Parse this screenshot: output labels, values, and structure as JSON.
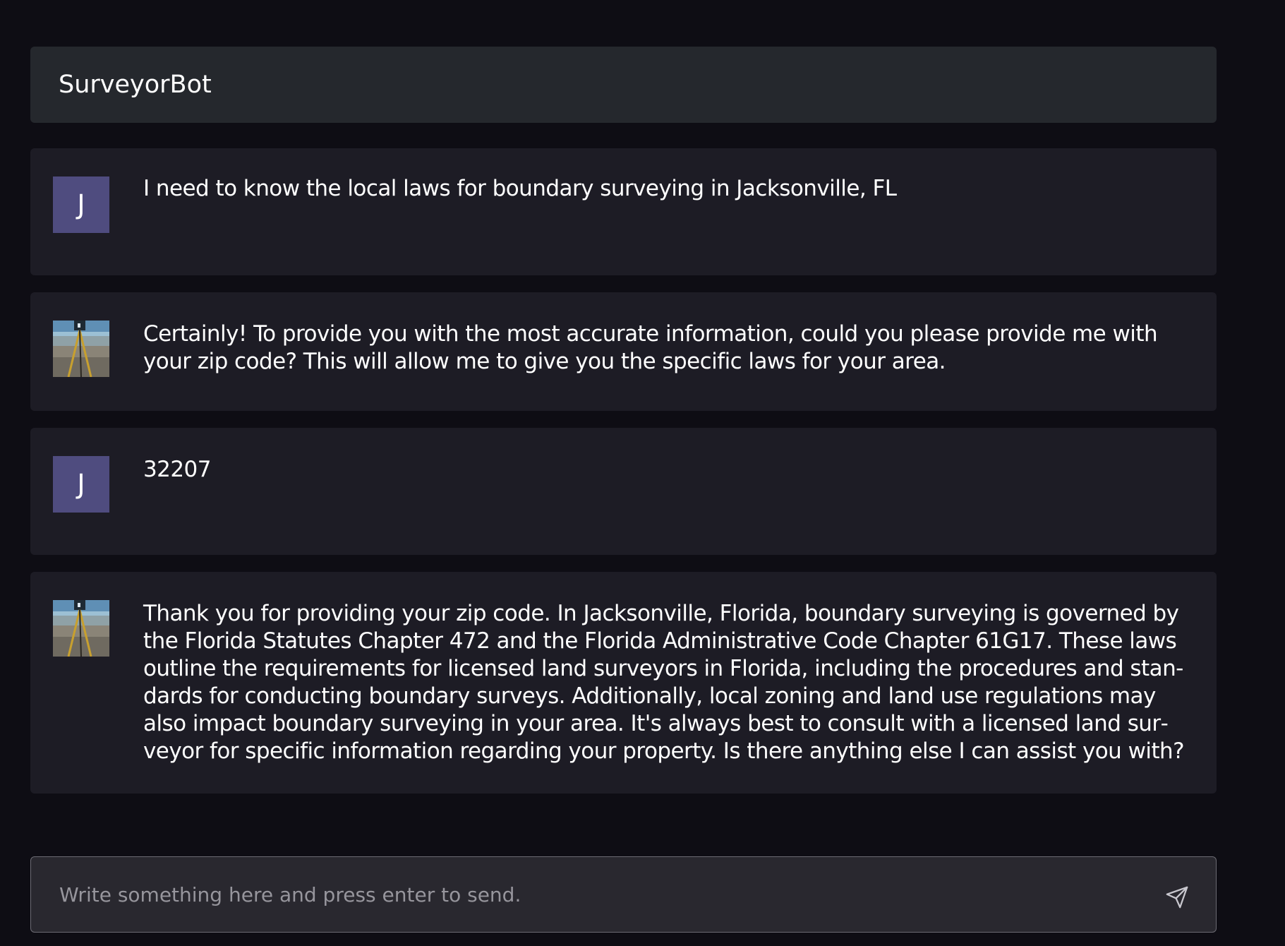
{
  "header": {
    "title": "SurveyorBot"
  },
  "messages": [
    {
      "role": "user",
      "avatar_initial": "J",
      "text": "I need to know the local laws for boundary surveying in Jacksonville, FL"
    },
    {
      "role": "bot",
      "avatar_icon": "surveyor-tripod-avatar",
      "text": "Certainly! To provide you with the most accurate information, could you please provide me with your zip code? This will allow me to give you the specific laws for your area."
    },
    {
      "role": "user",
      "avatar_initial": "J",
      "text": "32207"
    },
    {
      "role": "bot",
      "avatar_icon": "surveyor-tripod-avatar",
      "text": "Thank you for providing your zip code. In Jacksonville, Florida, boundary surveying is governed by the Florida Statutes Chapter 472 and the Florida Administrative Code Chapter 61G17. These laws outline the requirements for licensed land surveyors in Florida, including the procedures and stan­dards for conducting boundary surveys. Additionally, local zoning and land use regulations may also impact boundary surveying in your area. It's always best to consult with a licensed land sur­veyor for specific information regarding your property. Is there anything else I can assist you with?"
    }
  ],
  "composer": {
    "placeholder": "Write something here and press enter to send.",
    "value": "",
    "send_icon": "send-icon"
  },
  "colors": {
    "background": "#0e0d14",
    "header_bg": "#25282d",
    "message_bg": "#1d1c25",
    "user_avatar_bg": "#4f4c7f",
    "input_bg": "#29282f",
    "input_border": "#6c6b73",
    "text": "#ffffff",
    "placeholder": "#96959c"
  }
}
